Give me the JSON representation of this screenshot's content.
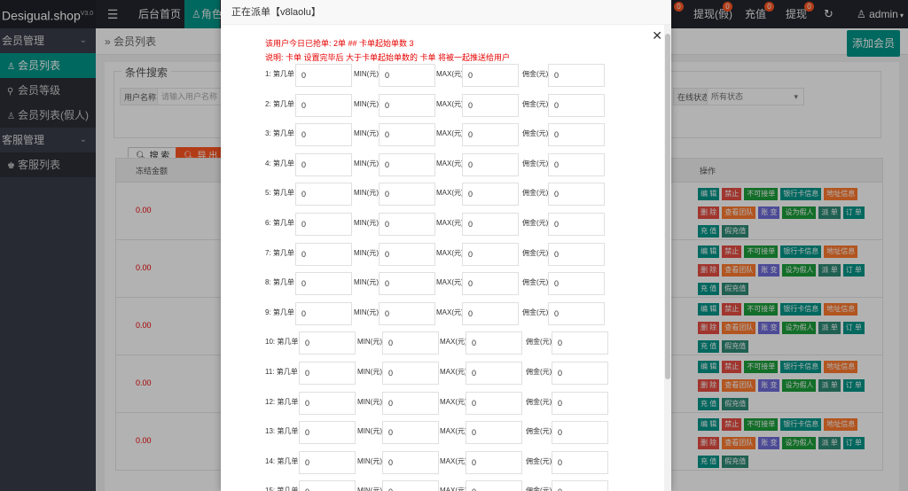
{
  "header": {
    "brand": "Desigual.shop",
    "version": "V3.0",
    "nav": [
      "后台首页",
      "角色"
    ],
    "right_items": [
      {
        "label": "提现(假)",
        "badge": "0"
      },
      {
        "label": "充值",
        "badge": "0"
      },
      {
        "label": "提现",
        "badge": "0"
      }
    ],
    "first_badge": "0",
    "user": "admin"
  },
  "sidebar": {
    "groups": [
      {
        "label": "会员管理",
        "items": [
          "会员列表",
          "会员等级",
          "会员列表(假人)"
        ]
      },
      {
        "label": "客服管理",
        "items": [
          "客服列表"
        ]
      }
    ]
  },
  "main": {
    "breadcrumb": "会员列表",
    "add_button": "添加会员",
    "search": {
      "legend": "条件搜索",
      "username_label": "用户名称",
      "username_placeholder": "请输入用户名称",
      "online_label": "在线状态",
      "online_value": "所有状态",
      "search_button": "搜 索",
      "export_button": "导 出"
    },
    "table": {
      "col_frozen": "冻结金额",
      "col_ops": "操作",
      "rows": [
        "0.00",
        "0.00",
        "0.00",
        "0.00",
        "0.00"
      ],
      "ops": [
        "编 辑",
        "禁止",
        "不可接单",
        "银行卡信息",
        "地址信息",
        "删 除",
        "查看团队",
        "账 变",
        "设为假人",
        "派 单",
        "订 单",
        "充 值",
        "假充值"
      ],
      "ops_colors": [
        "#009688",
        "#e54d42",
        "#1a9e3a",
        "#009688",
        "#ff7a2f",
        "#e54d42",
        "#ff7a2f",
        "#6f6cd8",
        "#1a9e3a",
        "#2d8a76",
        "#009688",
        "#009688",
        "#2d8a76"
      ]
    }
  },
  "modal": {
    "title": "正在派单【v8laolu】",
    "info_line1": "该用户今日已抢单: 2单 ## 卡单起始单数 3",
    "info_line2": "说明: 卡单 设置完毕后 大于卡单起始单数的 卡单 将被一起推送给用户",
    "labels": {
      "order": "第几单",
      "min": "MIN(元)",
      "max": "MAX(元)",
      "commission": "佣金(元)"
    },
    "rows": [
      {
        "n": "1:",
        "order": "0",
        "min": "0",
        "max": "0",
        "commission": "0"
      },
      {
        "n": "2:",
        "order": "0",
        "min": "0",
        "max": "0",
        "commission": "0"
      },
      {
        "n": "3:",
        "order": "0",
        "min": "0",
        "max": "0",
        "commission": "0"
      },
      {
        "n": "4:",
        "order": "0",
        "min": "0",
        "max": "0",
        "commission": "0"
      },
      {
        "n": "5:",
        "order": "0",
        "min": "0",
        "max": "0",
        "commission": "0"
      },
      {
        "n": "6:",
        "order": "0",
        "min": "0",
        "max": "0",
        "commission": "0"
      },
      {
        "n": "7:",
        "order": "0",
        "min": "0",
        "max": "0",
        "commission": "0"
      },
      {
        "n": "8:",
        "order": "0",
        "min": "0",
        "max": "0",
        "commission": "0"
      },
      {
        "n": "9:",
        "order": "0",
        "min": "0",
        "max": "0",
        "commission": "0"
      },
      {
        "n": "10:",
        "order": "0",
        "min": "0",
        "max": "0",
        "commission": "0"
      },
      {
        "n": "11:",
        "order": "0",
        "min": "0",
        "max": "0",
        "commission": "0"
      },
      {
        "n": "12:",
        "order": "0",
        "min": "0",
        "max": "0",
        "commission": "0"
      },
      {
        "n": "13:",
        "order": "0",
        "min": "0",
        "max": "0",
        "commission": "0"
      },
      {
        "n": "14:",
        "order": "0",
        "min": "0",
        "max": "0",
        "commission": "0"
      },
      {
        "n": "15:",
        "order": "0",
        "min": "0",
        "max": "0",
        "commission": "0"
      }
    ]
  }
}
